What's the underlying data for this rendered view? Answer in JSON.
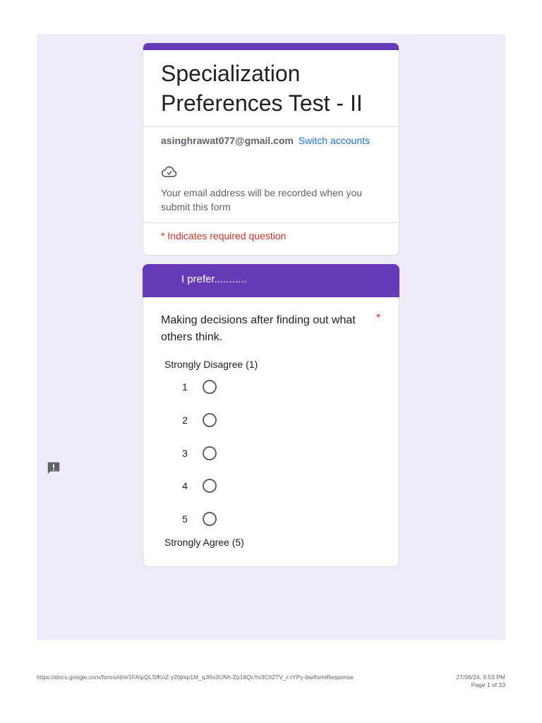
{
  "form": {
    "title": "Specialization Preferences Test - II",
    "account_email": "asinghrawat077@gmail.com",
    "switch_accounts": "Switch accounts",
    "email_note": "Your email address will be recorded when you submit this form",
    "required_note": "* Indicates required question",
    "accent_color": "#673ab7"
  },
  "section": {
    "title": "I prefer..........."
  },
  "question": {
    "text": "Making decisions after finding out what others think.",
    "required_star": "*",
    "low_label": "Strongly Disagree (1)",
    "high_label": "Strongly Agree (5)",
    "options": [
      "1",
      "2",
      "3",
      "4",
      "5"
    ]
  },
  "footer": {
    "url": "https://docs.google.com/forms/d/e/1FAIpQLSfKnZ-y20jmp1M_qJRx3UNh-Zp18QcYo3CIt2TV_r-rYPy-bw/formResponse",
    "datetime": "27/06/24, 9:53 PM",
    "page": "Page 1 of 33"
  },
  "icons": {
    "cloud": "cloud-check-icon",
    "feedback": "feedback-icon"
  }
}
